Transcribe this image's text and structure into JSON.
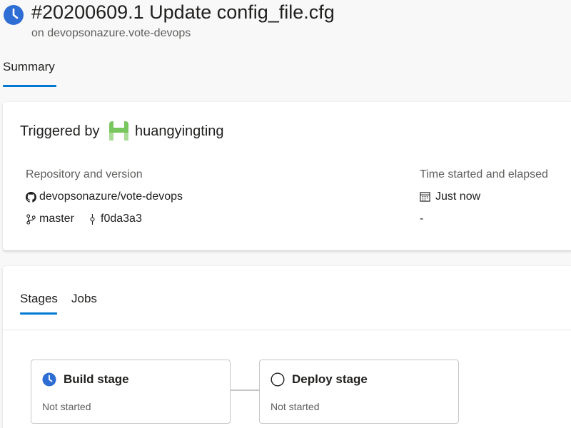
{
  "header": {
    "title": "#20200609.1 Update config_file.cfg",
    "subtitle": "on devopsonazure.vote-devops",
    "status_icon": "clock-icon"
  },
  "tabs": {
    "summary_label": "Summary"
  },
  "summary": {
    "triggered_by_label": "Triggered by",
    "user_name": "huangyingting",
    "repository_label": "Repository and version",
    "repository_name": "devopsonazure/vote-devops",
    "branch": "master",
    "commit": "f0da3a3",
    "time_label": "Time started and elapsed",
    "time_started": "Just now",
    "elapsed": "-"
  },
  "stages_panel": {
    "tab_stages": "Stages",
    "tab_jobs": "Jobs",
    "stages": [
      {
        "name": "Build stage",
        "status": "Not started",
        "icon": "clock-icon"
      },
      {
        "name": "Deploy stage",
        "status": "Not started",
        "icon": "empty-circle-icon"
      }
    ]
  },
  "colors": {
    "accent": "#0078d4",
    "status_blue": "#2e6dd4",
    "avatar_green": "#79c65e"
  }
}
